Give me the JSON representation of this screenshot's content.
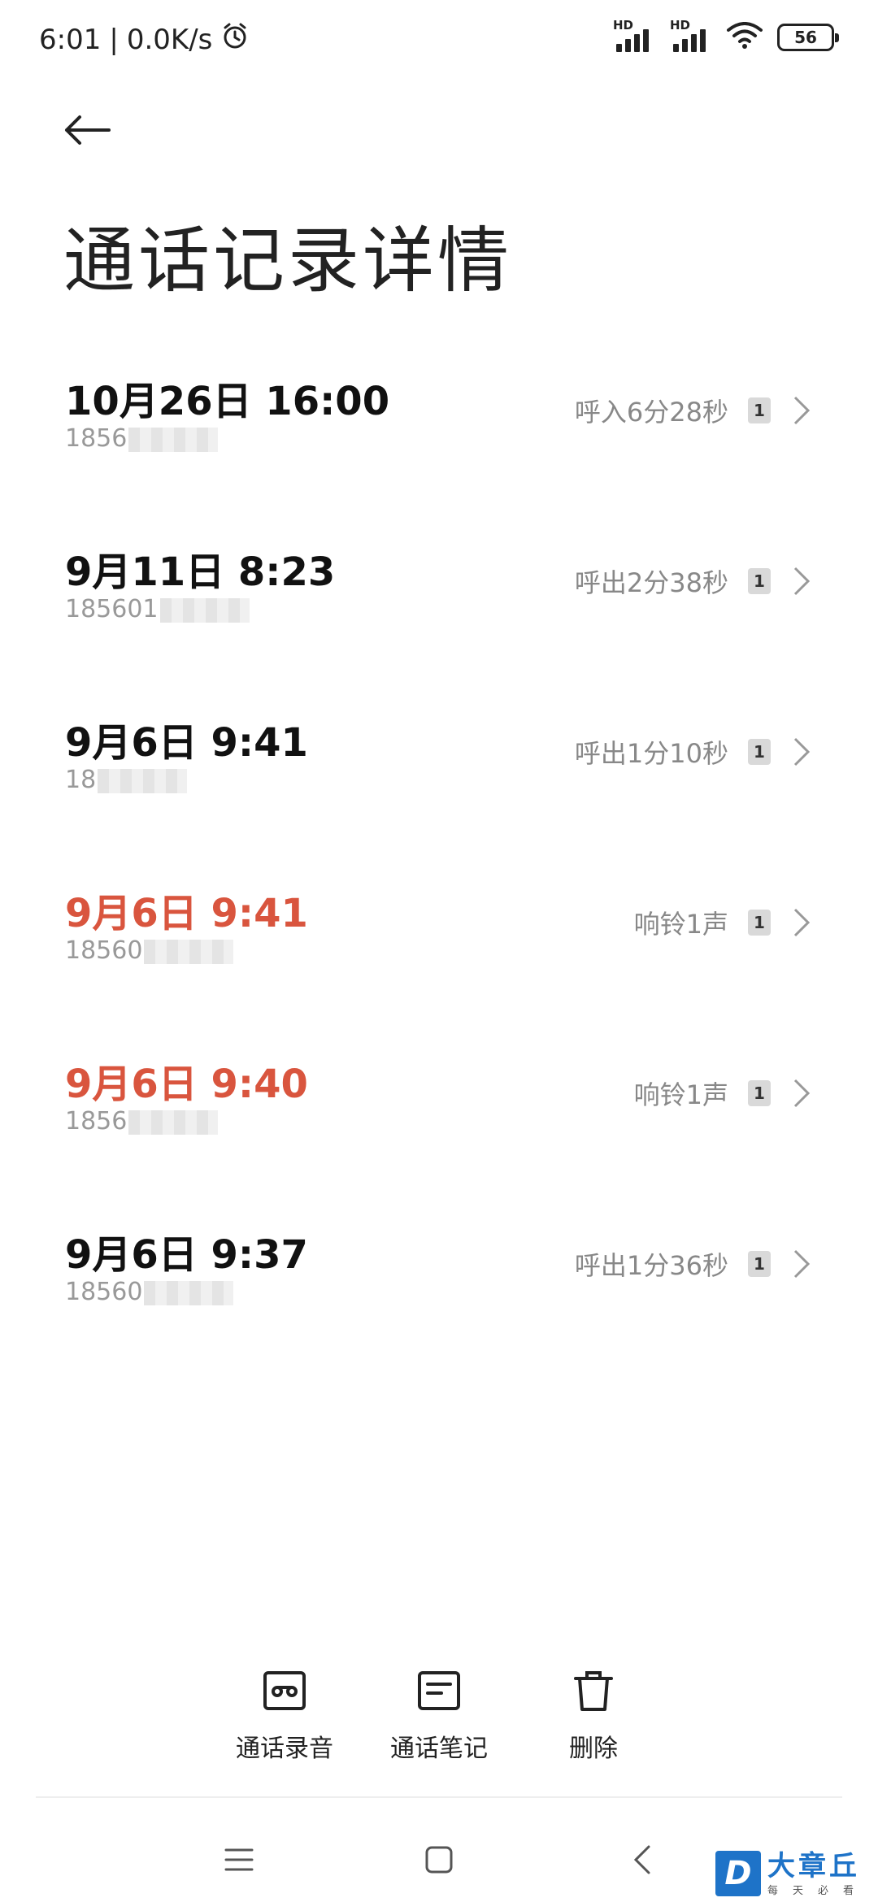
{
  "status_bar": {
    "time": "6:01",
    "separator": "|",
    "net_speed": "0.0K/s",
    "alarm_icon": "alarm-clock-icon",
    "signal_label_1": "HD",
    "signal_label_2": "HD",
    "battery": "56"
  },
  "header": {
    "back_icon": "arrow-left-icon",
    "title": "通话记录详情"
  },
  "calls": [
    {
      "time": "10月26日 16:00",
      "number": "1856",
      "summary": "呼入6分28秒",
      "sim": "1",
      "missed": false
    },
    {
      "time": "9月11日 8:23",
      "number": "185601",
      "summary": "呼出2分38秒",
      "sim": "1",
      "missed": false
    },
    {
      "time": "9月6日 9:41",
      "number": "18",
      "summary": "呼出1分10秒",
      "sim": "1",
      "missed": false
    },
    {
      "time": "9月6日 9:41",
      "number": "18560",
      "summary": "响铃1声",
      "sim": "1",
      "missed": true
    },
    {
      "time": "9月6日 9:40",
      "number": "1856",
      "summary": "响铃1声",
      "sim": "1",
      "missed": true
    },
    {
      "time": "9月6日 9:37",
      "number": "18560",
      "summary": "呼出1分36秒",
      "sim": "1",
      "missed": false
    }
  ],
  "colors": {
    "missed": "#d9553e",
    "text": "#111111",
    "secondary": "#888888"
  },
  "actions": {
    "recording_label": "通话录音",
    "notes_label": "通话笔记",
    "delete_label": "删除"
  },
  "watermark": {
    "logo_letter": "D",
    "title": "大章丘",
    "subtitle": "每天必看"
  }
}
